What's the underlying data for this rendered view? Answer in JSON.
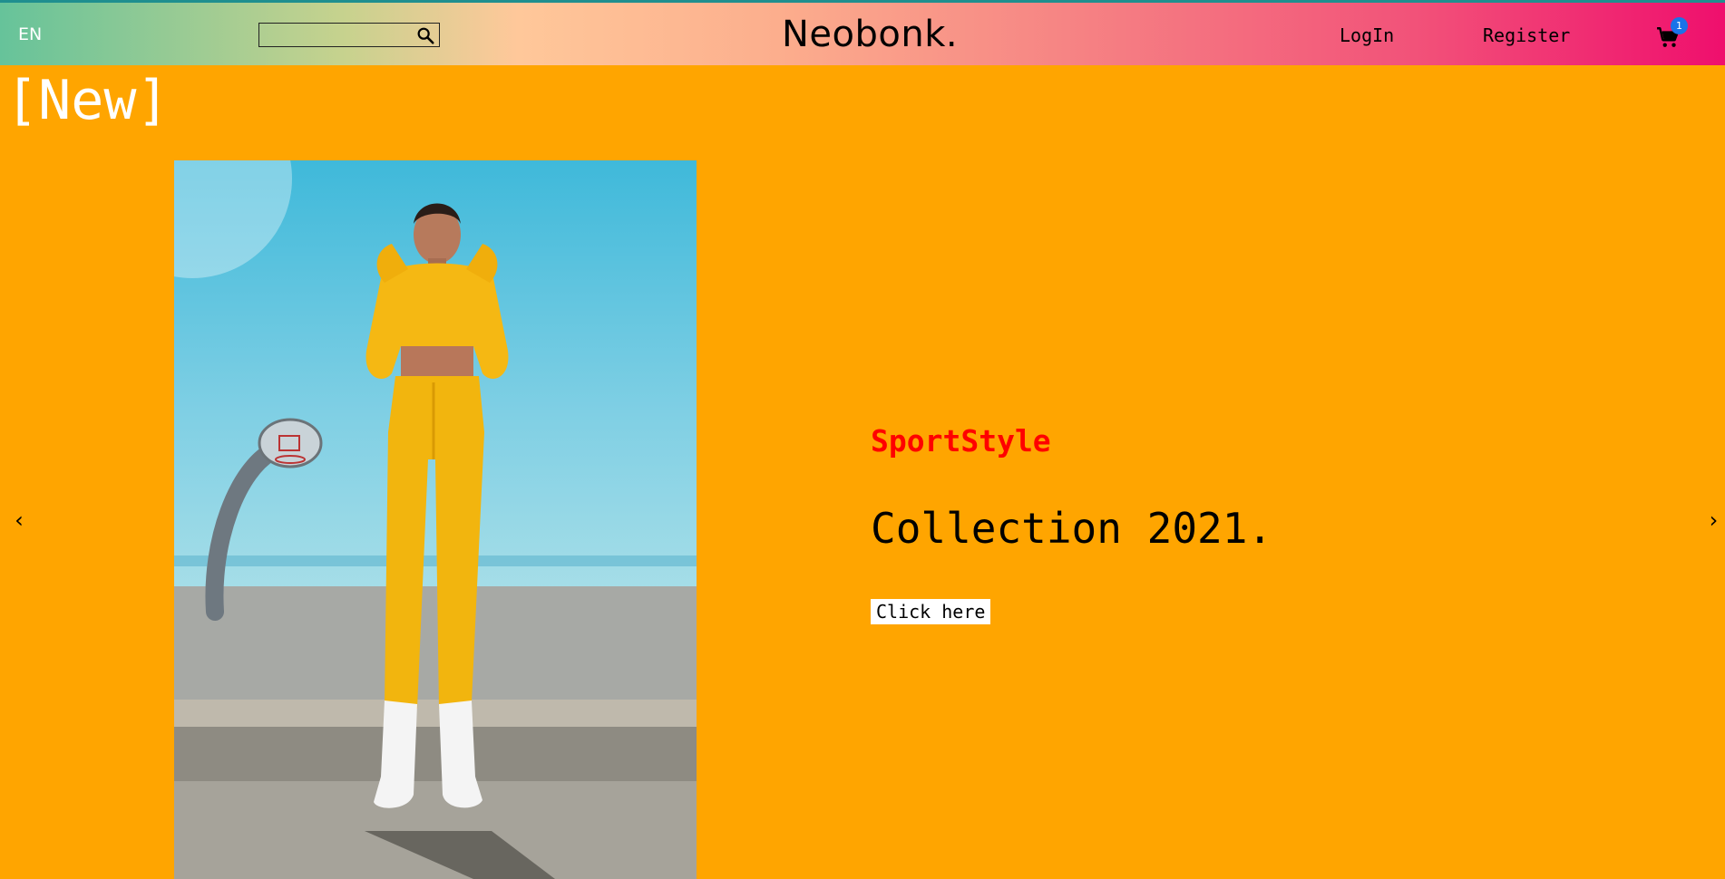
{
  "header": {
    "language": "EN",
    "search": {
      "value": "",
      "placeholder": ""
    },
    "logo": "Neobonk.",
    "login_label": "LogIn",
    "register_label": "Register",
    "cart_count": "1"
  },
  "hero": {
    "section_title": "[New]",
    "brand": "SportStyle",
    "headline": "Collection 2021.",
    "cta_label": "Click here",
    "prev_arrow": "‹",
    "next_arrow": "›"
  },
  "icons": {
    "search": "search-icon",
    "cart": "cart-icon",
    "prev": "chevron-left-icon",
    "next": "chevron-right-icon"
  },
  "colors": {
    "page_background": "#ffa500",
    "brand_text": "#ff0000",
    "badge": "#1a73e8"
  }
}
